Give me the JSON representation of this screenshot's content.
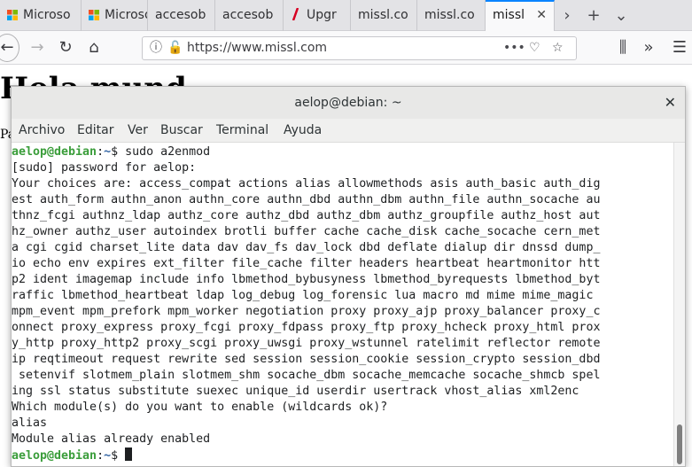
{
  "browser": {
    "tabs": [
      {
        "label": "Microso",
        "favicon": "ms"
      },
      {
        "label": "Microso",
        "favicon": "ms"
      },
      {
        "label": "accesob",
        "favicon": "page"
      },
      {
        "label": "accesob",
        "favicon": "page"
      },
      {
        "label": "Upgr",
        "favicon": "red"
      },
      {
        "label": "missl.co",
        "favicon": "page"
      },
      {
        "label": "missl.co",
        "favicon": "page"
      },
      {
        "label": "missl",
        "favicon": "page",
        "active": true
      }
    ],
    "url": "https://www.missl.com",
    "accent_color": "#0a84ff"
  },
  "page_behind": {
    "heading": "Hola mund",
    "side_text": "Pa"
  },
  "terminal": {
    "title": "aelop@debian: ~",
    "menu": [
      "Archivo",
      "Editar",
      "Ver",
      "Buscar",
      "Terminal",
      "Ayuda"
    ],
    "prompt_user": "aelop@debian",
    "prompt_sep": ":",
    "prompt_path": "~",
    "prompt_symbol": "$ ",
    "command": "sudo a2enmod",
    "output_lines": [
      "[sudo] password for aelop:",
      "Your choices are: access_compat actions alias allowmethods asis auth_basic auth_dig",
      "est auth_form authn_anon authn_core authn_dbd authn_dbm authn_file authn_socache au",
      "thnz_fcgi authnz_ldap authz_core authz_dbd authz_dbm authz_groupfile authz_host aut",
      "hz_owner authz_user autoindex brotli buffer cache cache_disk cache_socache cern_met",
      "a cgi cgid charset_lite data dav dav_fs dav_lock dbd deflate dialup dir dnssd dump_",
      "io echo env expires ext_filter file_cache filter headers heartbeat heartmonitor htt",
      "p2 ident imagemap include info lbmethod_bybusyness lbmethod_byrequests lbmethod_byt",
      "raffic lbmethod_heartbeat ldap log_debug log_forensic lua macro md mime mime_magic",
      "mpm_event mpm_prefork mpm_worker negotiation proxy proxy_ajp proxy_balancer proxy_c",
      "onnect proxy_express proxy_fcgi proxy_fdpass proxy_ftp proxy_hcheck proxy_html prox",
      "y_http proxy_http2 proxy_scgi proxy_uwsgi proxy_wstunnel ratelimit reflector remote",
      "ip reqtimeout request rewrite sed session session_cookie session_crypto session_dbd",
      " setenvif slotmem_plain slotmem_shm socache_dbm socache_memcache socache_shmcb spel",
      "ing ssl status substitute suexec unique_id userdir usertrack vhost_alias xml2enc",
      "Which module(s) do you want to enable (wildcards ok)?",
      "alias",
      "Module alias already enabled"
    ],
    "colors": {
      "user": "#3a9d3a",
      "path": "#3465a4"
    }
  }
}
